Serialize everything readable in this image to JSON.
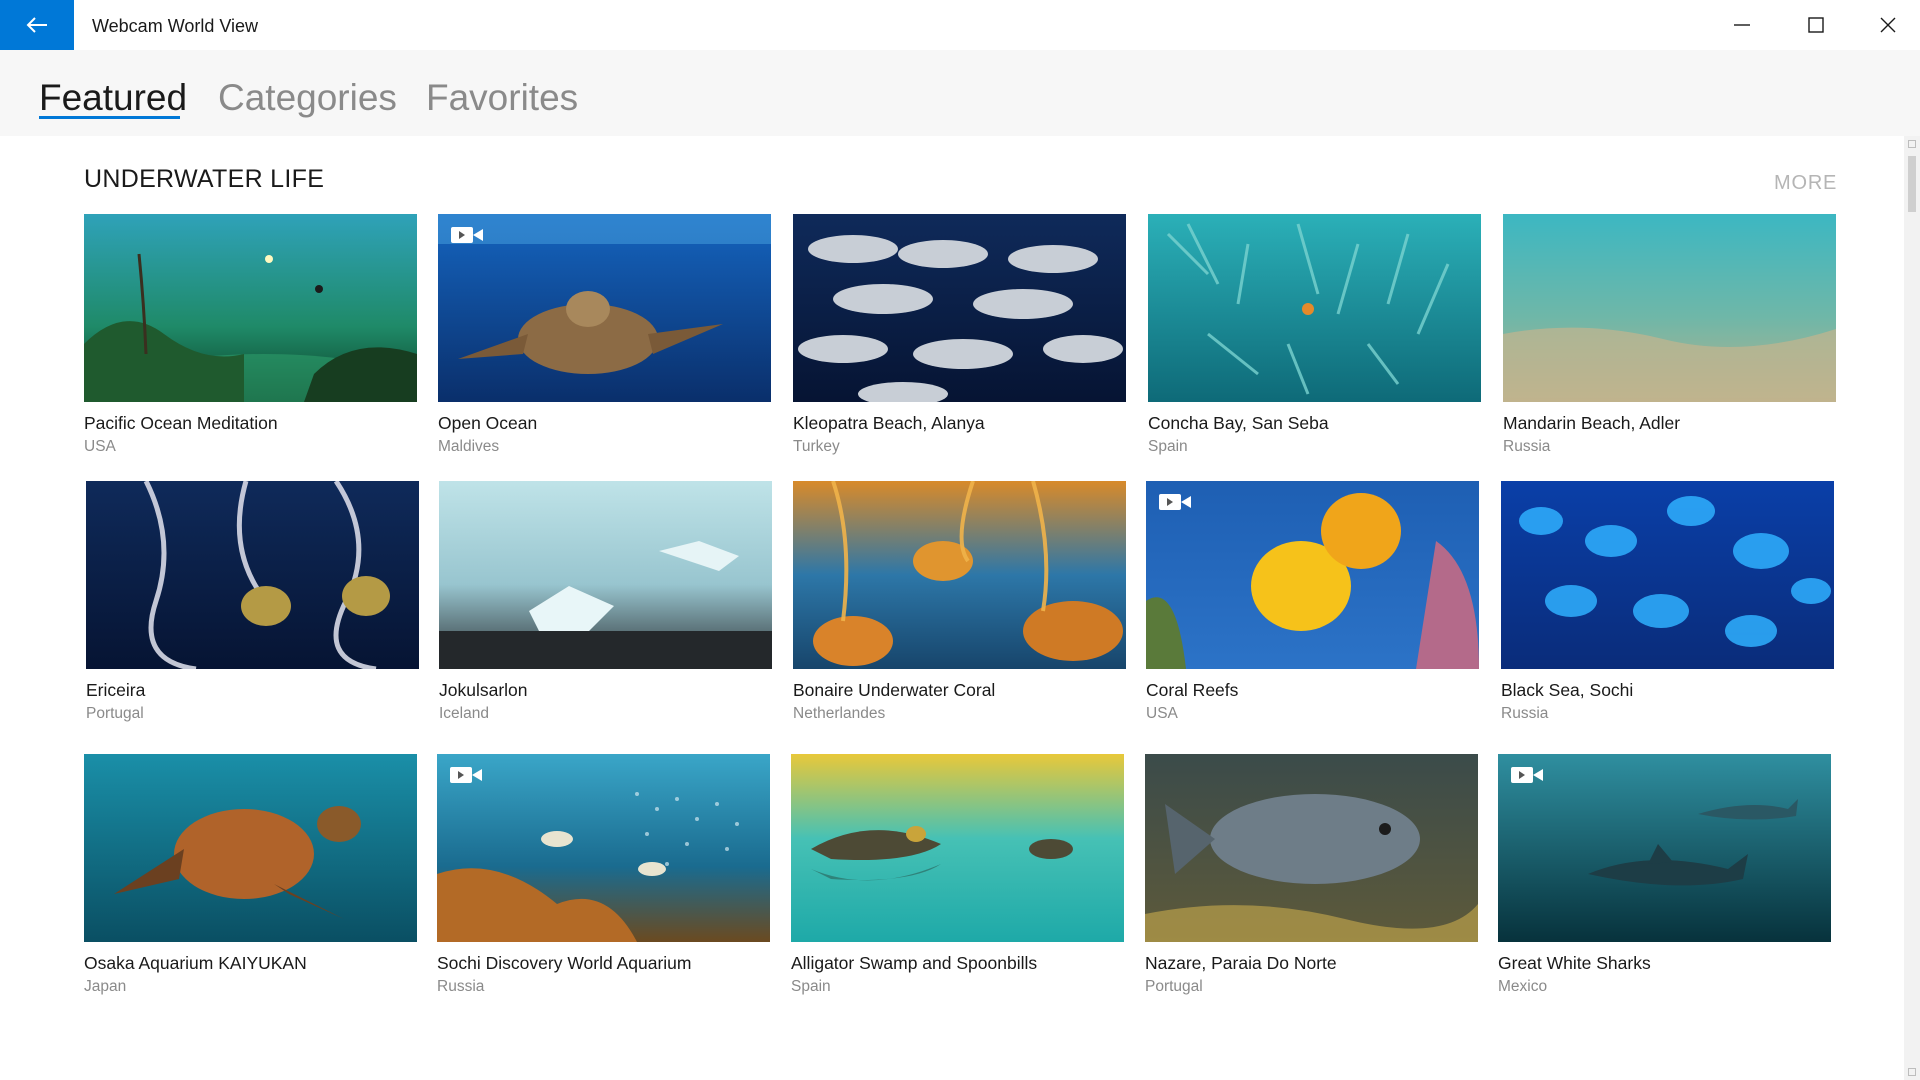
{
  "app": {
    "title": "Webcam World View"
  },
  "tabs": [
    "Featured",
    "Categories",
    "Favorites"
  ],
  "section": {
    "title": "UNDERWATER LIFE",
    "more": "MORE"
  },
  "colors": {
    "accent": "#0078d7"
  },
  "cards": [
    {
      "title": "Pacific Ocean Meditation",
      "location": "USA",
      "video": false
    },
    {
      "title": "Open Ocean",
      "location": "Maldives",
      "video": true
    },
    {
      "title": "Kleopatra Beach, Alanya",
      "location": "Turkey",
      "video": false
    },
    {
      "title": "Concha Bay, San Seba",
      "location": "Spain",
      "video": false
    },
    {
      "title": "Mandarin Beach, Adler",
      "location": "Russia",
      "video": false
    },
    {
      "title": "Ericeira",
      "location": "Portugal",
      "video": false
    },
    {
      "title": "Jokulsarlon",
      "location": "Iceland",
      "video": false
    },
    {
      "title": "Bonaire Underwater Coral",
      "location": "Netherlandes",
      "video": false
    },
    {
      "title": "Coral Reefs",
      "location": "USA",
      "video": true
    },
    {
      "title": "Black Sea, Sochi",
      "location": "Russia",
      "video": false
    },
    {
      "title": "Osaka Aquarium KAIYUKAN",
      "location": "Japan",
      "video": false
    },
    {
      "title": "Sochi Discovery World Aquarium",
      "location": "Russia",
      "video": true
    },
    {
      "title": "Alligator Swamp and Spoonbills",
      "location": "Spain",
      "video": false
    },
    {
      "title": "Nazare, Paraia Do Norte",
      "location": "Portugal",
      "video": false
    },
    {
      "title": "Great White Sharks",
      "location": "Mexico",
      "video": true
    }
  ]
}
